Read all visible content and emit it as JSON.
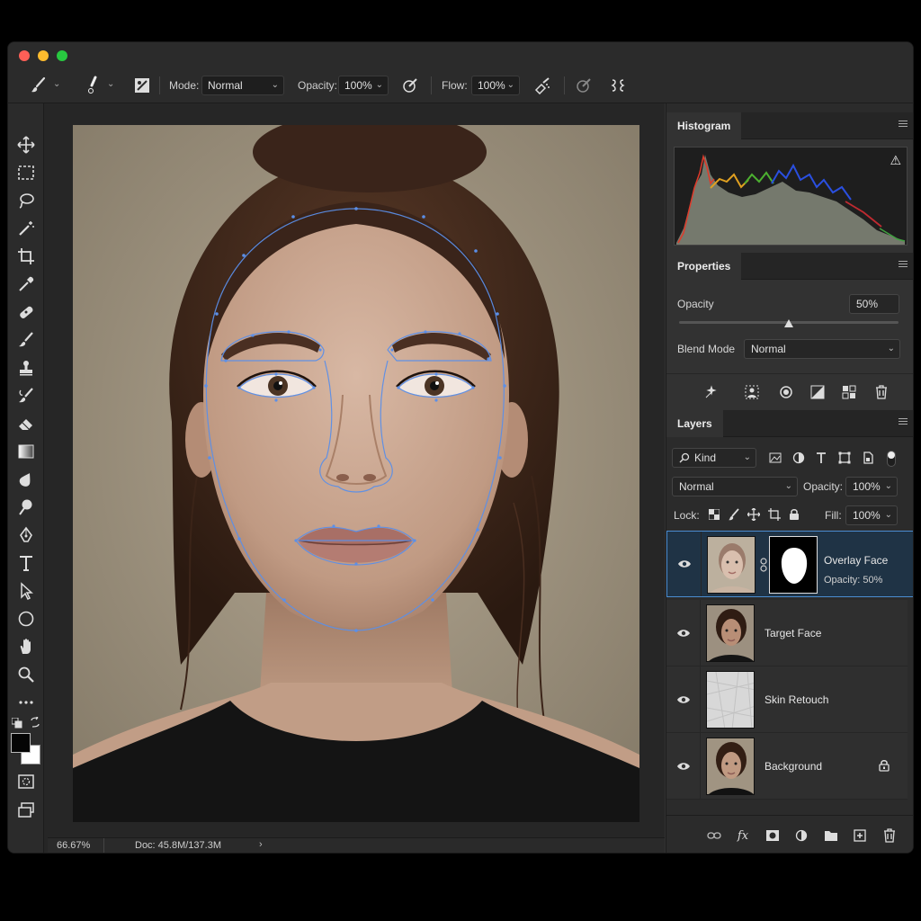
{
  "options_bar": {
    "mode_label": "Mode:",
    "mode_value": "Normal",
    "opacity_label": "Opacity:",
    "opacity_value": "100%",
    "flow_label": "Flow:",
    "flow_value": "100%"
  },
  "tools": [
    "move-tool-icon",
    "marquee-tool-icon",
    "lasso-tool-icon",
    "magic-wand-icon",
    "crop-tool-icon",
    "eyedropper-icon",
    "healing-brush-icon",
    "brush-tool-icon",
    "clone-stamp-icon",
    "history-brush-icon",
    "eraser-icon",
    "gradient-tool-icon",
    "blur-tool-icon",
    "dodge-tool-icon",
    "pen-tool-icon",
    "type-tool-icon",
    "path-selection-icon",
    "ellipse-tool-icon",
    "hand-tool-icon",
    "zoom-tool-icon"
  ],
  "status": {
    "zoom": "66.67%",
    "doc": "Doc: 45.8M/137.3M"
  },
  "histogram": {
    "tab": "Histogram",
    "warning": "⚠"
  },
  "properties": {
    "tab": "Properties",
    "opacity_label": "Opacity",
    "opacity_value": "50%",
    "opacity_level": 0.5,
    "blend_label": "Blend Mode",
    "blend_value": "Normal"
  },
  "layers": {
    "tab": "Layers",
    "kind": "Kind",
    "blend": "Normal",
    "opacity_label": "Opacity:",
    "opacity_value": "100%",
    "lock_label": "Lock:",
    "fill_label": "Fill:",
    "fill_value": "100%",
    "items": [
      {
        "name": "Overlay Face",
        "sub": "Opacity: 50%"
      },
      {
        "name": "Target Face"
      },
      {
        "name": "Skin Retouch"
      },
      {
        "name": "Background"
      }
    ]
  },
  "colors": {
    "accent": "#4b8dd1",
    "panel": "#323232",
    "selected_row": "#1f3345"
  }
}
